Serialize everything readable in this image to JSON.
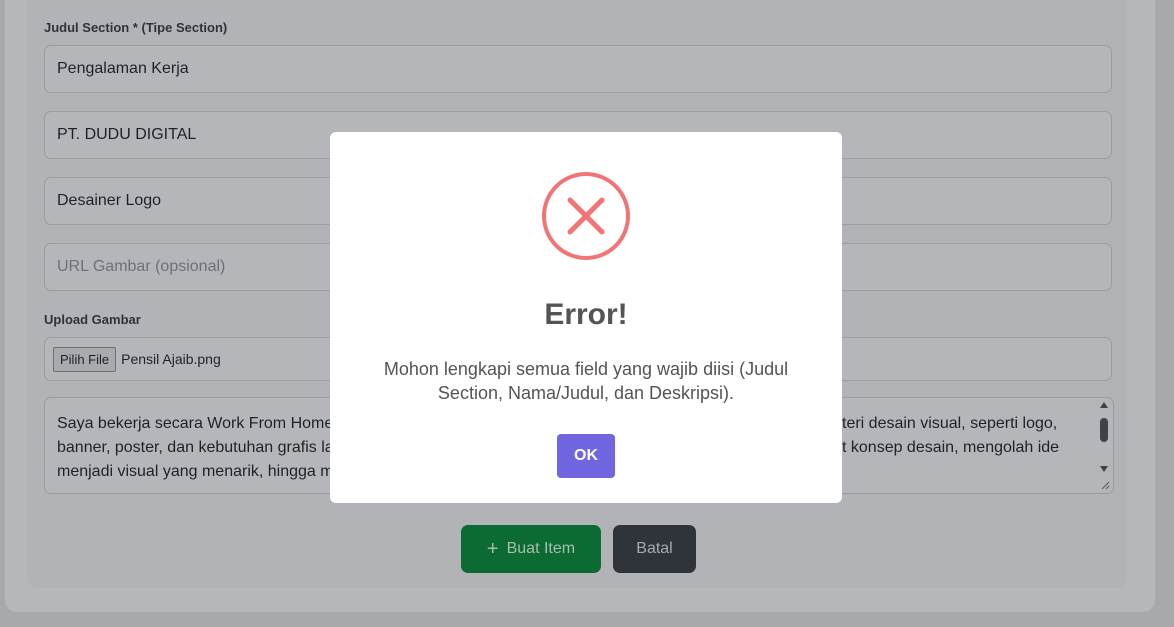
{
  "form": {
    "section_label": "Judul Section * (Tipe Section)",
    "section_title_value": "Pengalaman Kerja",
    "company_value": "PT. DUDU DIGITAL",
    "role_value": "Desainer Logo",
    "image_url_placeholder": "URL Gambar (opsional)",
    "upload_label": "Upload Gambar",
    "file_button": "Pilih File",
    "file_name": "Pensil Ajaib.png",
    "description_line1_left": "Saya bekerja secara Work From Home (",
    "description_line1_right": "teri desain visual, seperti logo,",
    "description_line2_left": "banner, poster, dan kebutuhan grafis la",
    "description_line2_right": "t konsep desain, mengolah ide",
    "description_line3_left": "menjadi visual yang menarik, hingga m"
  },
  "buttons": {
    "create_icon": "+",
    "create_label": "Buat Item",
    "cancel_label": "Batal"
  },
  "modal": {
    "icon": "error-x-icon",
    "title": "Error!",
    "message": "Mohon lengkapi semua field yang wajib diisi (Judul Section, Nama/Judul, dan Deskripsi).",
    "ok_label": "OK",
    "accent_color": "#f27474",
    "button_color": "#7066e0"
  }
}
